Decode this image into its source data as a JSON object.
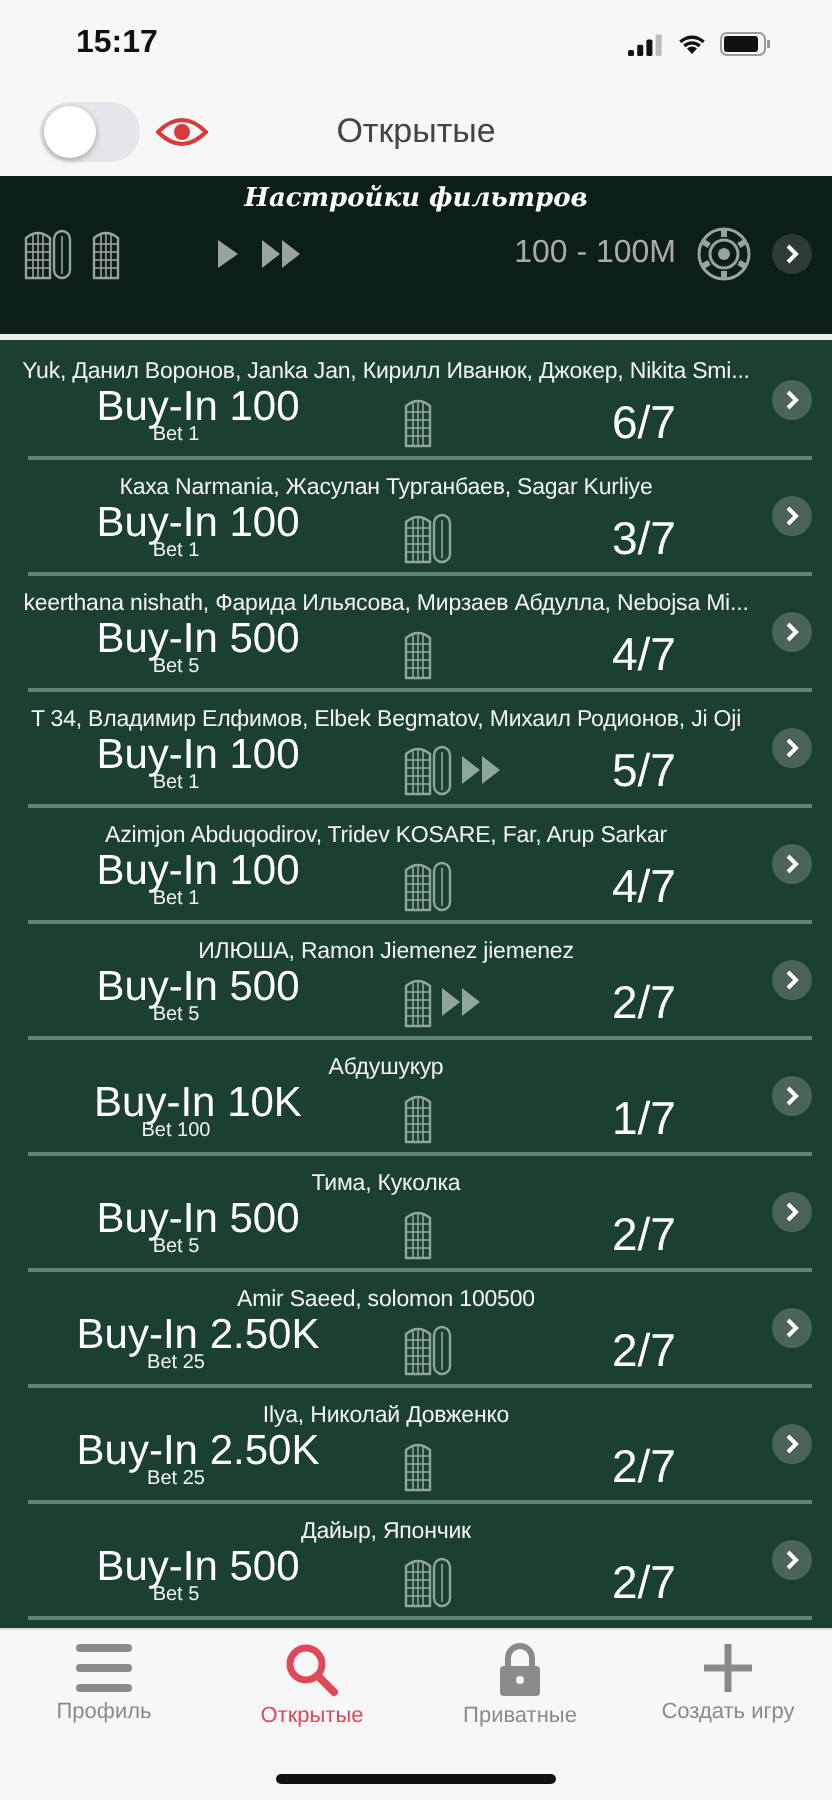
{
  "status_bar": {
    "time": "15:17"
  },
  "top_bar": {
    "title": "Открытые",
    "toggle": {
      "on": false
    }
  },
  "filters": {
    "title": "Настройки фильтров",
    "decks": [
      {
        "kind": "double",
        "selected": true
      },
      {
        "kind": "single",
        "selected": true
      }
    ],
    "speeds": [
      {
        "kind": "normal",
        "selected": true
      },
      {
        "kind": "fast",
        "selected": true
      }
    ],
    "range": "100 - 100M"
  },
  "games": [
    {
      "players": "Yuk, Данил Воронов, Janka Jan, Кирилл Иванюк, Джокер, Nikita Smi...",
      "buy_in": "Buy-In 100",
      "bet": "Bet 1",
      "kind": "single",
      "fast": false,
      "seats": "6/7"
    },
    {
      "players": "Каха Narmania, Жасулан Турганбаев, Sagar Kurliye",
      "buy_in": "Buy-In 100",
      "bet": "Bet 1",
      "kind": "double",
      "fast": false,
      "seats": "3/7"
    },
    {
      "players": "keerthana nishath, Фарида Ильясова, Мирзаев Абдулла, Nebojsa Mi...",
      "buy_in": "Buy-In 500",
      "bet": "Bet 5",
      "kind": "single",
      "fast": false,
      "seats": "4/7"
    },
    {
      "players": "T 34, Владимир Елфимов, Elbek Begmatov, Михаил Родионов, Ji Oji",
      "buy_in": "Buy-In 100",
      "bet": "Bet 1",
      "kind": "double",
      "fast": true,
      "seats": "5/7"
    },
    {
      "players": "Azimjon Abduqodirov, Tridev KOSARE, Far, Arup Sarkar",
      "buy_in": "Buy-In 100",
      "bet": "Bet 1",
      "kind": "double",
      "fast": false,
      "seats": "4/7"
    },
    {
      "players": "ИЛЮША, Ramon Jiemenez jiemenez",
      "buy_in": "Buy-In 500",
      "bet": "Bet 5",
      "kind": "single",
      "fast": true,
      "seats": "2/7"
    },
    {
      "players": "Абдушукур",
      "buy_in": "Buy-In 10K",
      "bet": "Bet 100",
      "kind": "single",
      "fast": false,
      "seats": "1/7"
    },
    {
      "players": "Тима, Куколка",
      "buy_in": "Buy-In 500",
      "bet": "Bet 5",
      "kind": "single",
      "fast": false,
      "seats": "2/7"
    },
    {
      "players": "Amir Saeed, solomon 100500",
      "buy_in": "Buy-In 2.50K",
      "bet": "Bet 25",
      "kind": "double",
      "fast": false,
      "seats": "2/7"
    },
    {
      "players": "Ilya, Николай Довженко",
      "buy_in": "Buy-In 2.50K",
      "bet": "Bet 25",
      "kind": "single",
      "fast": false,
      "seats": "2/7"
    },
    {
      "players": "Дайыр, Япончик",
      "buy_in": "Buy-In 500",
      "bet": "Bet 5",
      "kind": "double",
      "fast": false,
      "seats": "2/7"
    }
  ],
  "tab_bar": [
    {
      "kind": "menu",
      "label": "Профиль",
      "selected": false
    },
    {
      "kind": "search",
      "label": "Открытые",
      "selected": true
    },
    {
      "kind": "lock",
      "label": "Приватные",
      "selected": false
    },
    {
      "kind": "plus",
      "label": "Создать игру",
      "selected": false
    }
  ]
}
